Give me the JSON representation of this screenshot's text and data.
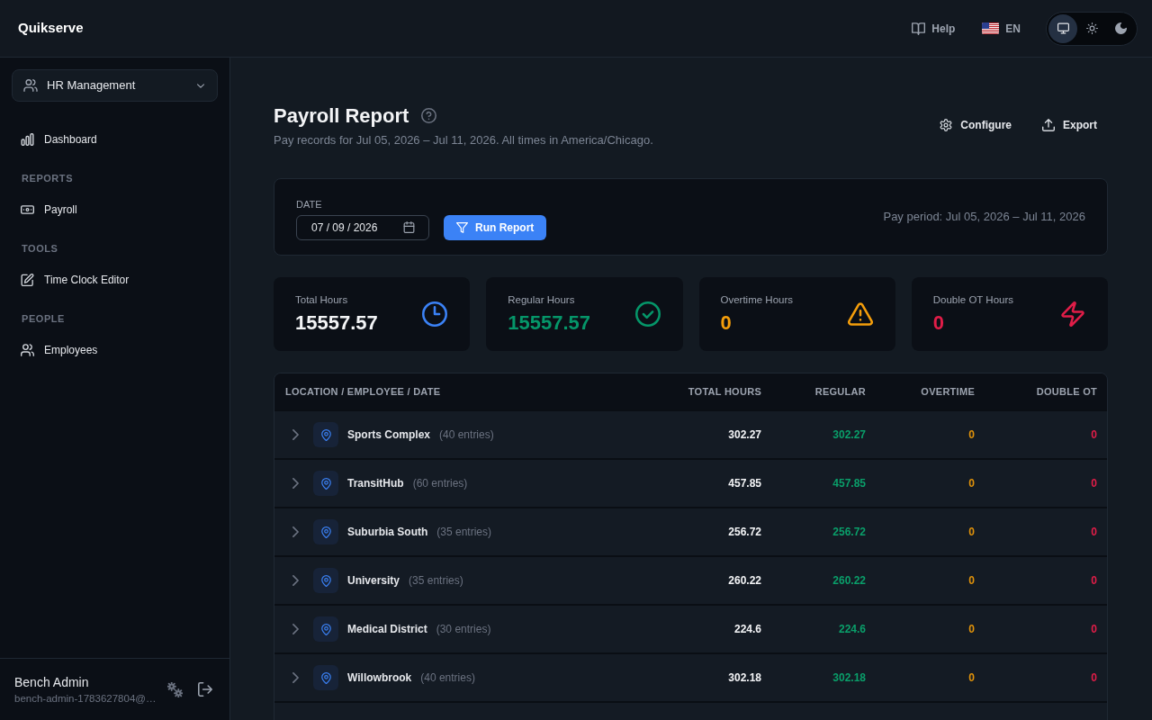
{
  "top_bar": {
    "app_name": "Quikserve",
    "help": "Help",
    "language": "EN",
    "theme_options": [
      {
        "kind": "system",
        "selected": true
      },
      {
        "kind": "light",
        "selected": false
      },
      {
        "kind": "dark",
        "selected": false
      }
    ]
  },
  "sidebar": {
    "workspace": "HR Management",
    "items": [
      {
        "kind": "link",
        "label": "Dashboard",
        "selected": false
      },
      {
        "kind": "section",
        "label": "REPORTS"
      },
      {
        "kind": "link",
        "label": "Payroll",
        "selected": false
      },
      {
        "kind": "section",
        "label": "TOOLS"
      },
      {
        "kind": "link",
        "label": "Time Clock Editor",
        "selected": false
      },
      {
        "kind": "section",
        "label": "PEOPLE"
      },
      {
        "kind": "link",
        "label": "Employees",
        "selected": false
      }
    ],
    "user": {
      "name": "Bench Admin",
      "email": "bench-admin-1783627804@…"
    }
  },
  "page": {
    "title": "Payroll Report",
    "subtitle": "Pay records for Jul 05, 2026 – Jul 11, 2026. All times in America/Chicago.",
    "actions": [
      "Configure",
      "Export"
    ]
  },
  "filter": {
    "date_label": "DATE",
    "date_value": "07 / 09 / 2026",
    "run_button": "Run Report",
    "pay_period": "Pay period: Jul 05, 2026 – Jul 11, 2026"
  },
  "stats": [
    {
      "kind": "total",
      "label": "Total Hours",
      "value": "15557.57",
      "color": "#3b82f6"
    },
    {
      "kind": "regular",
      "label": "Regular Hours",
      "value": "15557.57",
      "color": "#059669"
    },
    {
      "kind": "overtime",
      "label": "Overtime Hours",
      "value": "0",
      "color": "#f59e0b"
    },
    {
      "kind": "double_ot",
      "label": "Double OT Hours",
      "value": "0",
      "color": "#e11d48"
    }
  ],
  "table": {
    "columns": [
      "LOCATION / EMPLOYEE / DATE",
      "TOTAL HOURS",
      "REGULAR",
      "OVERTIME",
      "DOUBLE OT"
    ],
    "rows": [
      {
        "name": "Sports Complex",
        "entries": "(40 entries)",
        "expanded": false,
        "total": "302.27",
        "regular": "302.27",
        "overtime": "0",
        "double_ot": "0"
      },
      {
        "name": "TransitHub",
        "entries": "(60 entries)",
        "expanded": false,
        "total": "457.85",
        "regular": "457.85",
        "overtime": "0",
        "double_ot": "0"
      },
      {
        "name": "Suburbia South",
        "entries": "(35 entries)",
        "expanded": false,
        "total": "256.72",
        "regular": "256.72",
        "overtime": "0",
        "double_ot": "0"
      },
      {
        "name": "University",
        "entries": "(35 entries)",
        "expanded": false,
        "total": "260.22",
        "regular": "260.22",
        "overtime": "0",
        "double_ot": "0"
      },
      {
        "name": "Medical District",
        "entries": "(30 entries)",
        "expanded": false,
        "total": "224.6",
        "regular": "224.6",
        "overtime": "0",
        "double_ot": "0"
      },
      {
        "name": "Willowbrook",
        "entries": "(40 entries)",
        "expanded": false,
        "total": "302.18",
        "regular": "302.18",
        "overtime": "0",
        "double_ot": "0"
      }
    ]
  }
}
